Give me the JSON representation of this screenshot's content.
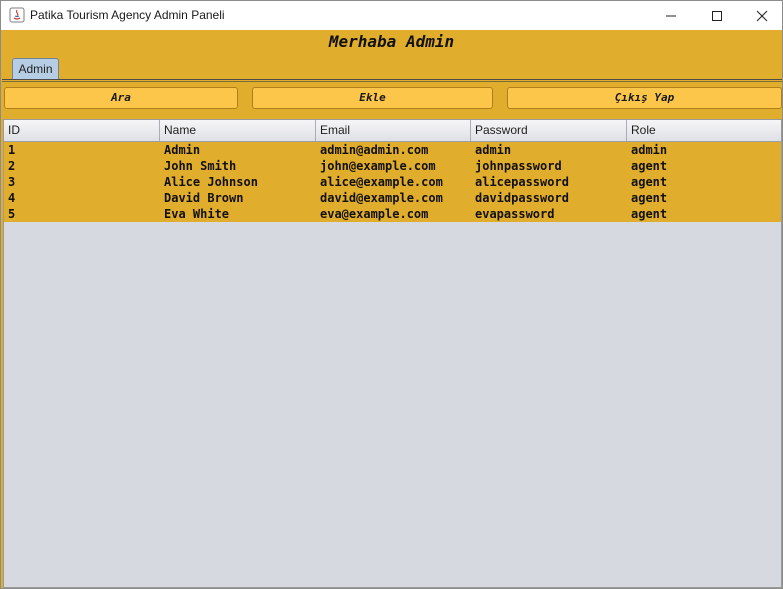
{
  "window": {
    "title": "Patika Tourism Agency Admin Paneli"
  },
  "header": {
    "title": "Merhaba Admin"
  },
  "tabs": [
    {
      "label": "Admin"
    }
  ],
  "toolbar": {
    "search_label": "Ara",
    "add_label": "Ekle",
    "logout_label": "Çıkış Yap"
  },
  "table": {
    "columns": [
      "ID",
      "Name",
      "Email",
      "Password",
      "Role"
    ],
    "rows": [
      [
        "1",
        "Admin",
        "admin@admin.com",
        "admin",
        "admin"
      ],
      [
        "2",
        "John Smith",
        "john@example.com",
        "johnpassword",
        "agent"
      ],
      [
        "3",
        "Alice Johnson",
        "alice@example.com",
        "alicepassword",
        "agent"
      ],
      [
        "4",
        "David Brown",
        "david@example.com",
        "davidpassword",
        "agent"
      ],
      [
        "5",
        "Eva White",
        "eva@example.com",
        "evapassword",
        "agent"
      ]
    ]
  },
  "colors": {
    "accent": "#e1ad2c",
    "button": "#fcc64a",
    "table_background": "#d7d9e0",
    "tab": "#b7cde4"
  },
  "icons": {
    "app": "java-app-icon",
    "minimize": "minimize-icon",
    "maximize": "maximize-icon",
    "close": "close-icon"
  }
}
